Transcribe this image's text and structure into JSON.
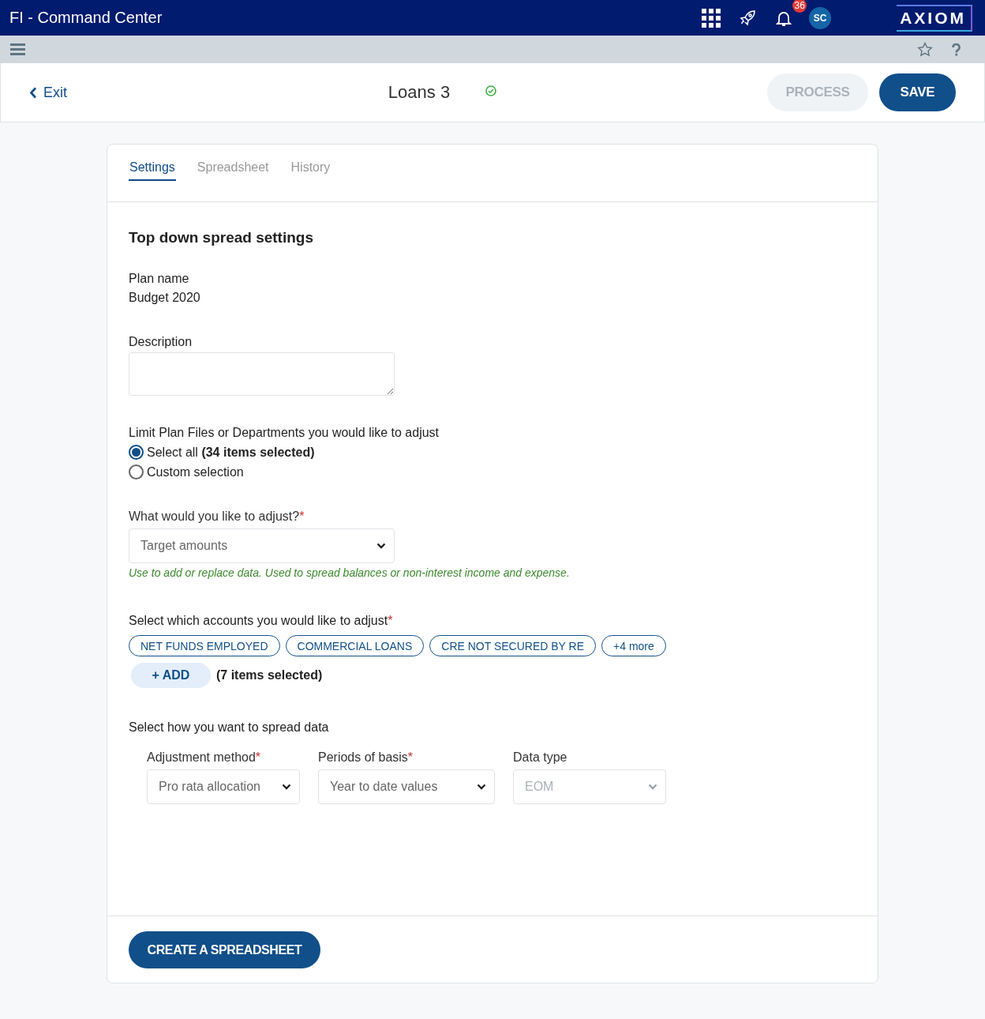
{
  "app": {
    "title": "FI - Command Center",
    "notifications": "36",
    "avatar": "SC",
    "logo": "AXIOM"
  },
  "page": {
    "back": "Exit",
    "title": "Loans 3",
    "saved": true,
    "buttons": [
      {
        "label": "PROCESS",
        "kind": "secondary",
        "disabled": true
      },
      {
        "label": "SAVE",
        "kind": "primary",
        "disabled": false
      }
    ]
  },
  "tabs": [
    {
      "label": "Settings",
      "selected": true
    },
    {
      "label": "Spreadsheet",
      "selected": false
    },
    {
      "label": "History",
      "selected": false
    }
  ],
  "section_title": "Top down spread settings",
  "required_mark": "*",
  "plan_name": {
    "label": "Plan name",
    "value": "Budget 2020"
  },
  "description": {
    "label": "Description"
  },
  "limit": {
    "label": "Limit Plan Files or Departments you would like to adjust",
    "options": [
      {
        "label": "Select all **(34 items selected)**",
        "selected": true
      },
      {
        "label": "Custom selection",
        "selected": false
      }
    ]
  },
  "adjust": {
    "label": "What would you like to adjust?",
    "required": true,
    "value": "Target amounts",
    "hint": "Use to add or replace data. Used to spread balances or non-interest income and expense."
  },
  "accounts": {
    "label": "Select which accounts you would like to adjust",
    "required": true,
    "chips": [
      "NET FUNDS EMPLOYED",
      "COMMERCIAL LOANS",
      "CRE NOT SECURED BY RE",
      "+4 more"
    ],
    "add": "+ ADD",
    "count": "(7 items selected)"
  },
  "spread": {
    "label": "Select how you want to spread data",
    "fields": [
      {
        "label": "Adjustment method",
        "required": true,
        "value": "Pro rata allocation",
        "disabled": false
      },
      {
        "label": "Periods of basis",
        "required": true,
        "value": "Year to date values",
        "disabled": false
      },
      {
        "label": "Data type",
        "required": false,
        "value": "EOM",
        "disabled": true
      }
    ]
  },
  "footer_button": "CREATE A SPREADSHEET"
}
